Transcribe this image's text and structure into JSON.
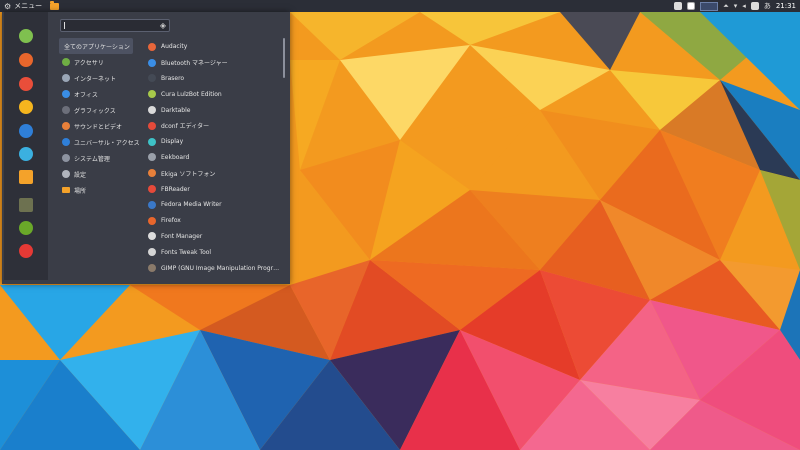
{
  "wallpaper_colors": [
    "#f6a21e",
    "#fbc438",
    "#f0781e",
    "#e8432a",
    "#26a9e8",
    "#1c86d6",
    "#f4517e",
    "#7a9e2a"
  ],
  "top_panel": {
    "menu_label": "メニュー",
    "clock": "21:31"
  },
  "menu": {
    "search": {
      "value": "",
      "placeholder": ""
    },
    "favorites": [
      {
        "name": "software-manager",
        "color": "#7fc04f"
      },
      {
        "name": "firefox",
        "color": "#e8662c"
      },
      {
        "name": "thunderbird",
        "color": "#e94e3a"
      },
      {
        "name": "media-player",
        "color": "#f5b51e"
      },
      {
        "name": "document-viewer",
        "color": "#2f7fd8"
      },
      {
        "name": "text-editor",
        "color": "#3bb0e0"
      },
      {
        "name": "files",
        "color": "#f4a22a"
      },
      {
        "name": "lock-screen",
        "color": "#6d7150"
      },
      {
        "name": "logout",
        "color": "#6aa829"
      },
      {
        "name": "shutdown",
        "color": "#e53935"
      }
    ],
    "categories": [
      {
        "label": "全てのアプリケーション",
        "icon": "none",
        "color": ""
      },
      {
        "label": "アクセサリ",
        "icon": "accessories-icon",
        "color": "#6fae44"
      },
      {
        "label": "インターネット",
        "icon": "internet-icon",
        "color": "#9aa6b6"
      },
      {
        "label": "オフィス",
        "icon": "office-icon",
        "color": "#3a8ee6"
      },
      {
        "label": "グラフィックス",
        "icon": "graphics-icon",
        "color": "#6c6f7a"
      },
      {
        "label": "サウンドとビデオ",
        "icon": "multimedia-icon",
        "color": "#e8803a"
      },
      {
        "label": "ユニバーサル・アクセス",
        "icon": "accessibility-icon",
        "color": "#2f7fd8"
      },
      {
        "label": "システム管理",
        "icon": "system-icon",
        "color": "#8d93a0"
      },
      {
        "label": "設定",
        "icon": "settings-icon",
        "color": "#b0b4bd"
      },
      {
        "label": "場所",
        "icon": "folder-icon",
        "color": "#f4a22a"
      }
    ],
    "apps": [
      {
        "label": "Audacity",
        "color": "#e8663a"
      },
      {
        "label": "Bluetooth マネージャー",
        "color": "#3a8ee6"
      },
      {
        "label": "Brasero",
        "color": "#444a55"
      },
      {
        "label": "Cura LulzBot Edition",
        "color": "#a7c94a"
      },
      {
        "label": "Darktable",
        "color": "#d9d9d9"
      },
      {
        "label": "dconf エディター",
        "color": "#e44a3a"
      },
      {
        "label": "Display",
        "color": "#3ec2c7"
      },
      {
        "label": "Eekboard",
        "color": "#9aa0aa"
      },
      {
        "label": "Ekiga ソフトフォン",
        "color": "#e8803a"
      },
      {
        "label": "FBReader",
        "color": "#e64a3a"
      },
      {
        "label": "Fedora Media Writer",
        "color": "#3a78c8"
      },
      {
        "label": "Firefox",
        "color": "#e8662c"
      },
      {
        "label": "Font Manager",
        "color": "#dcdcdc"
      },
      {
        "label": "Fonts Tweak Tool",
        "color": "#d4d4d4"
      },
      {
        "label": "GIMP (GNU Image Manipulation Progr…",
        "color": "#8a7a6a"
      }
    ]
  }
}
